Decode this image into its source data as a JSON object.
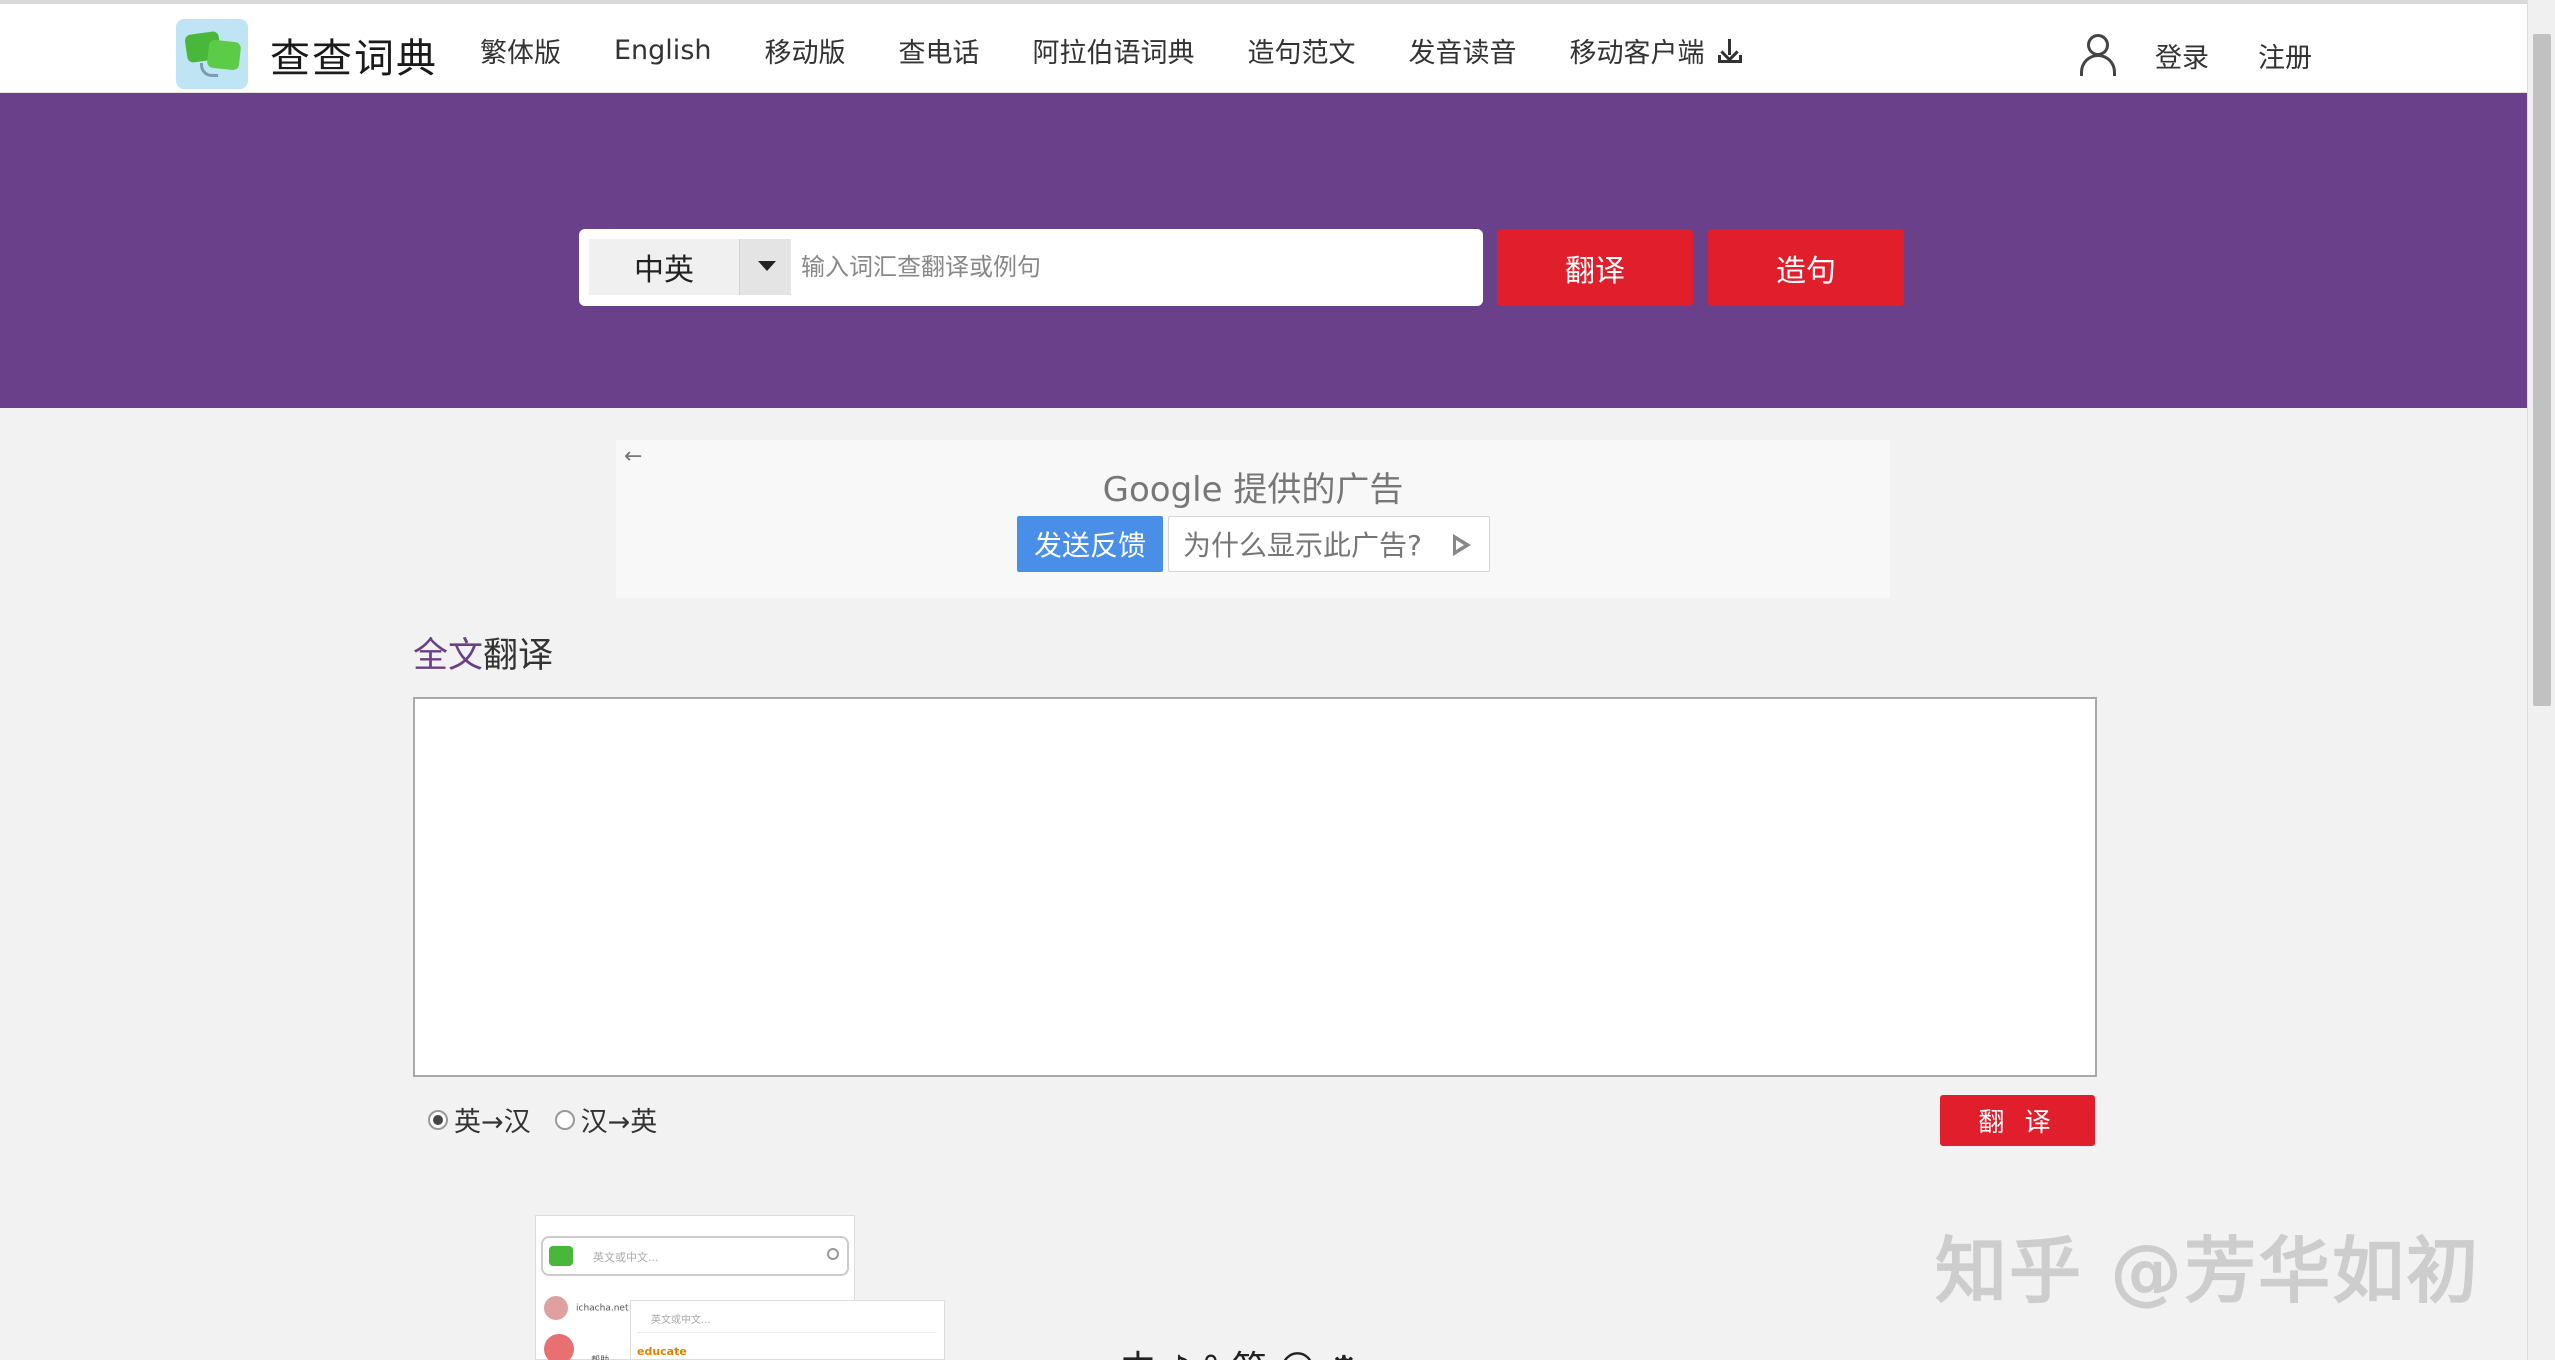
{
  "header": {
    "logo_text": "查查词典",
    "nav_items": [
      "繁体版",
      "English",
      "移动版",
      "查电话",
      "阿拉伯语词典",
      "造句范文",
      "发音读音",
      "移动客户端"
    ],
    "login": "登录",
    "register": "注册"
  },
  "search": {
    "lang": "中英",
    "placeholder": "输入词汇查翻译或例句",
    "translate_btn": "翻译",
    "sentence_btn": "造句"
  },
  "ad": {
    "back_arrow": "←",
    "title": "Google 提供的广告",
    "feedback_btn": "发送反馈",
    "why_btn": "为什么显示此广告?"
  },
  "full_translation": {
    "title_highlight": "全文",
    "title_rest": "翻译",
    "radio_en_zh": "英→汉",
    "radio_zh_en": "汉→英",
    "translate_btn": "翻 译"
  },
  "preview": {
    "search_placeholder": "英文或中文...",
    "site_text": "ichacha.net",
    "help_text": "帮助",
    "sub_placeholder": "英文或中文...",
    "word": "educate"
  },
  "watermark": "知乎 @芳华如初",
  "bottom_glyphs": "中 ♪ ° 简 ☺ ⚙",
  "colors": {
    "hero": "#6a408a",
    "accent_red": "#e01e2c",
    "ad_blue": "#4a8fe7"
  }
}
